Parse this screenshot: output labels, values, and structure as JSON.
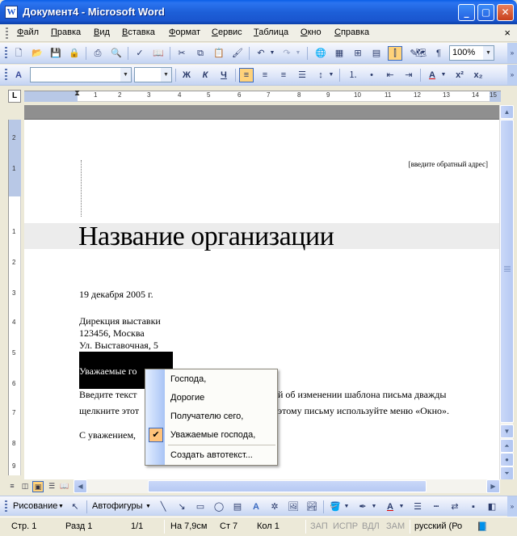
{
  "window": {
    "title": "Документ4 - Microsoft Word",
    "app_icon": "W"
  },
  "menu": [
    "Файл",
    "Правка",
    "Вид",
    "Вставка",
    "Формат",
    "Сервис",
    "Таблица",
    "Окно",
    "Справка"
  ],
  "toolbar": {
    "zoom": "100%"
  },
  "formatting": {
    "style": "",
    "font": "",
    "size": "",
    "bold": "Ж",
    "italic": "К",
    "underline": "Ч"
  },
  "ruler": {
    "h_ticks": [
      "1",
      "2",
      "3",
      "4",
      "5",
      "6",
      "7",
      "8",
      "9",
      "10",
      "11",
      "12",
      "13",
      "14",
      "15"
    ],
    "v_ticks": [
      "2",
      "1",
      "1",
      "2",
      "3",
      "4",
      "5",
      "6",
      "7",
      "8",
      "9"
    ]
  },
  "document": {
    "return_address": "[введите обратный адрес]",
    "org_name": "Название организации",
    "date": "19 декабря 2005 г.",
    "addr1": "Дирекция выставки",
    "addr2": "123456, Москва",
    "addr3": "Ул. Выставочная, 5",
    "salutation": "Уважаемые го",
    "body1a": "Введите текст",
    "body1b": "й об изменении шаблона письма дважды",
    "body2a": "щелкните этот",
    "body2b": "этому письму используйте меню «Окно».",
    "closing": "С уважением,"
  },
  "context_menu": {
    "items": [
      "Господа,",
      "Дорогие",
      "Получателю сего,",
      "Уважаемые господа,"
    ],
    "checked_index": 3,
    "autotext": "Создать автотекст..."
  },
  "drawing": {
    "draw_label": "Рисование",
    "autoshapes_label": "Автофигуры"
  },
  "status": {
    "page": "Стр.  1",
    "section": "Разд  1",
    "pages": "1/1",
    "at": "На  7,9см",
    "line": "Ст  7",
    "col": "Кол  1",
    "rec": "ЗАП",
    "trk": "ИСПР",
    "ext": "ВДЛ",
    "ovr": "ЗАМ",
    "lang": "русский (Ро"
  },
  "colors": {
    "titlebar": "#1A56CF",
    "highlight": "#FFD27A"
  }
}
